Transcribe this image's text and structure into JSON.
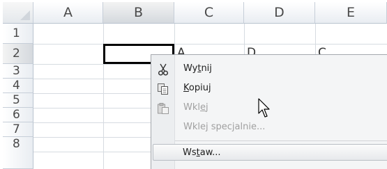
{
  "columns": [
    "A",
    "B",
    "C",
    "D",
    "E"
  ],
  "rows": [
    "1",
    "2",
    "3",
    "4",
    "5",
    "6",
    "7",
    "8"
  ],
  "selected_cell": "B2",
  "partial_cells": {
    "C2": "A",
    "D2": "D",
    "E2": "C"
  },
  "context_menu": {
    "items": [
      {
        "pre": "Wy",
        "acc": "t",
        "post": "nij",
        "icon": "scissors-icon",
        "enabled": true
      },
      {
        "pre": "",
        "acc": "K",
        "post": "opiuj",
        "icon": "copy-icon",
        "enabled": true
      },
      {
        "pre": "Wkl",
        "acc": "e",
        "post": "j",
        "icon": "paste-icon",
        "enabled": false
      },
      {
        "pre": "Wkle",
        "acc": "j",
        "post": " specjalnie...",
        "icon": "",
        "enabled": false
      },
      {
        "pre": "Ws",
        "acc": "t",
        "post": "aw...",
        "icon": "",
        "enabled": true,
        "highlighted": true
      }
    ]
  },
  "colors": {
    "selection_border": "#000000",
    "header_selected": "#d5d9de",
    "menu_bg": "#f4f5f6",
    "disabled_text": "#a0a0a0"
  }
}
